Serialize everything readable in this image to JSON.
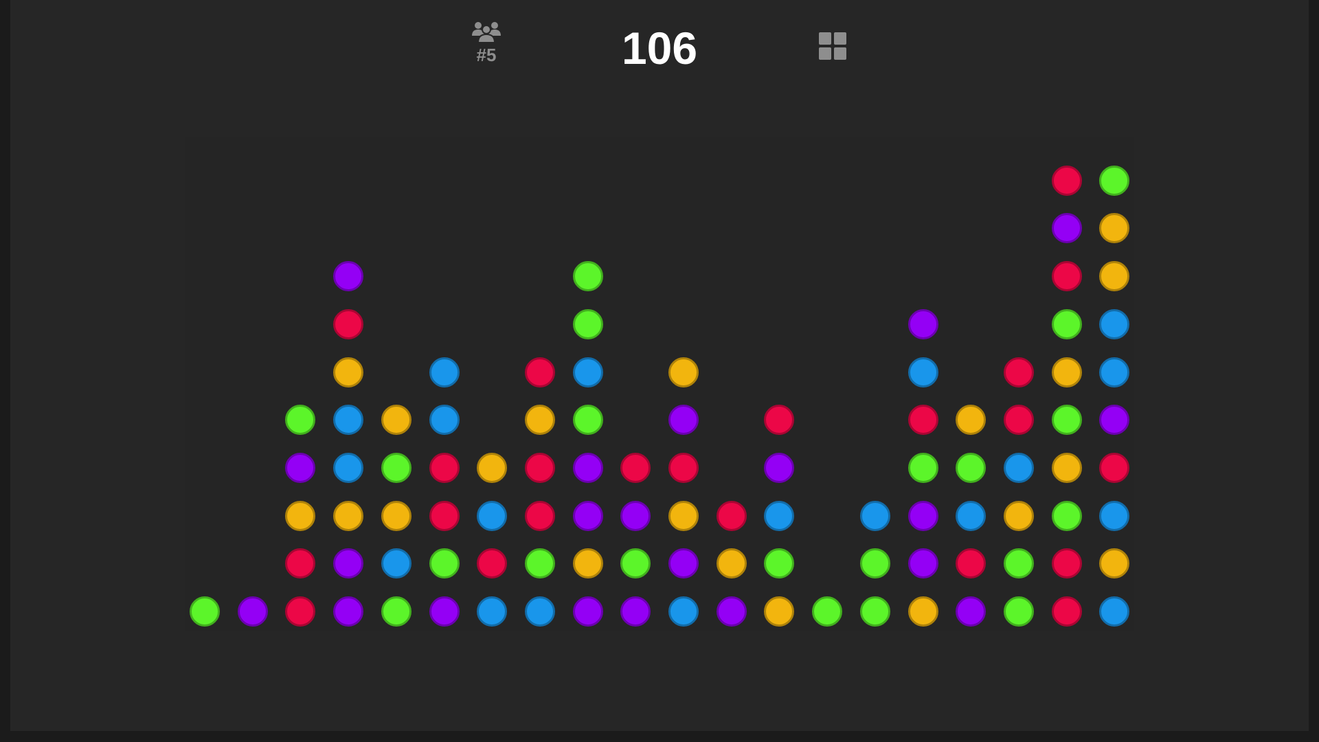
{
  "header": {
    "players_icon": "players-group-icon",
    "rank": "#5",
    "score": "106",
    "menu_icon": "grid-menu-icon"
  },
  "colors": {
    "background": "#262626",
    "text_primary": "#ffffff",
    "text_muted": "#8e8e8e",
    "G": "#5cf52a",
    "P": "#9400f5",
    "R": "#ec0747",
    "B": "#1996eb",
    "Y": "#f2b50e"
  },
  "board": {
    "columns": [
      [
        "G"
      ],
      [
        "P"
      ],
      [
        "R",
        "R",
        "Y",
        "P",
        "G"
      ],
      [
        "P",
        "P",
        "Y",
        "B",
        "B",
        "Y",
        "R",
        "P"
      ],
      [
        "G",
        "B",
        "Y",
        "G",
        "Y"
      ],
      [
        "P",
        "G",
        "R",
        "R",
        "B",
        "B"
      ],
      [
        "B",
        "R",
        "B",
        "Y"
      ],
      [
        "B",
        "G",
        "R",
        "R",
        "Y",
        "R"
      ],
      [
        "P",
        "Y",
        "P",
        "P",
        "G",
        "B",
        "G",
        "G"
      ],
      [
        "P",
        "G",
        "P",
        "R"
      ],
      [
        "B",
        "P",
        "Y",
        "R",
        "P",
        "Y"
      ],
      [
        "P",
        "Y",
        "R"
      ],
      [
        "Y",
        "G",
        "B",
        "P",
        "R"
      ],
      [
        "G"
      ],
      [
        "G",
        "G",
        "B"
      ],
      [
        "Y",
        "P",
        "P",
        "G",
        "R",
        "B",
        "P"
      ],
      [
        "P",
        "R",
        "B",
        "G",
        "Y"
      ],
      [
        "G",
        "G",
        "Y",
        "B",
        "R",
        "R"
      ],
      [
        "R",
        "R",
        "G",
        "Y",
        "G",
        "Y",
        "G",
        "R",
        "P",
        "R"
      ],
      [
        "B",
        "Y",
        "B",
        "R",
        "P",
        "B",
        "B",
        "Y",
        "Y",
        "G"
      ]
    ]
  }
}
